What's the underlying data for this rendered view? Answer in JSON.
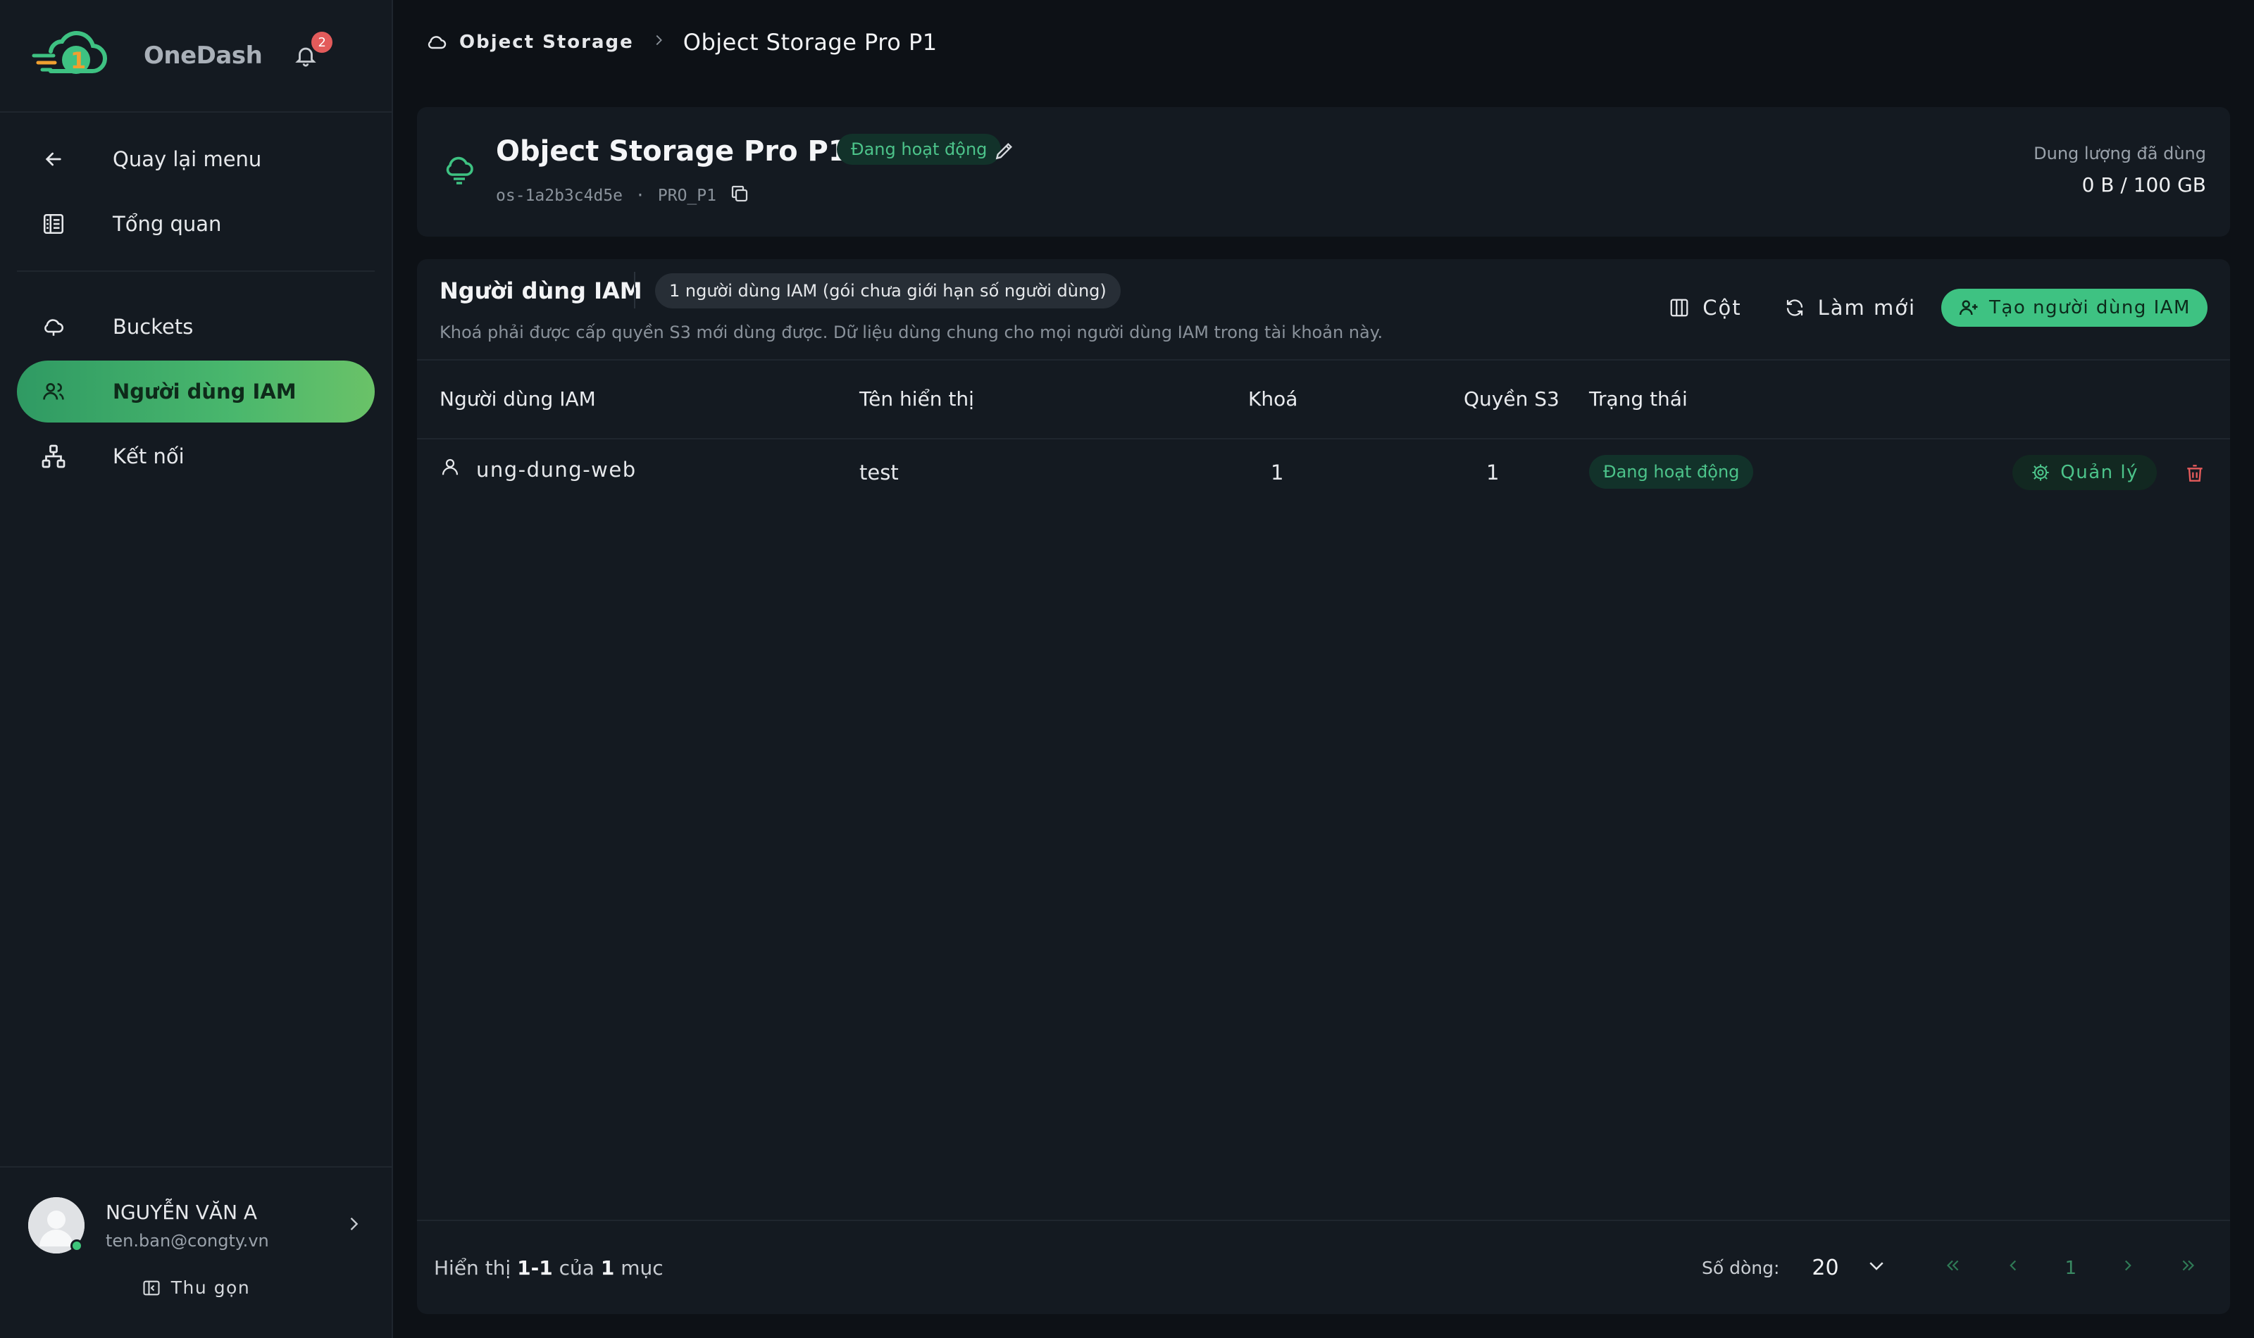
{
  "app": {
    "name": "OneDash",
    "notification_count": "2",
    "accent": "#3ec282"
  },
  "sidebar": {
    "top_items": [
      {
        "label": "Quay lại menu",
        "icon": "arrow-left-icon"
      },
      {
        "label": "Tổng quan",
        "icon": "overview-icon"
      }
    ],
    "items": [
      {
        "label": "Buckets",
        "icon": "cloud-icon"
      },
      {
        "label": "Người dùng IAM",
        "icon": "users-icon",
        "active": true
      },
      {
        "label": "Kết nối",
        "icon": "network-icon"
      }
    ],
    "user": {
      "name": "NGUYỄN VĂN A",
      "email": "ten.ban@congty.vn"
    },
    "collapse_label": "Thu gọn"
  },
  "breadcrumb": {
    "root": "Object Storage",
    "current": "Object Storage Pro P1"
  },
  "header": {
    "title": "Object Storage Pro P1",
    "status": "Đang hoạt động",
    "id": "os-1a2b3c4d5e",
    "separator": "·",
    "plan": "PRO_P1",
    "usage_label": "Dung lượng đã dùng",
    "usage_value": "0 B / 100 GB"
  },
  "iam": {
    "title": "Người dùng IAM",
    "count_badge": "1 người dùng IAM (gói chưa giới hạn số người dùng)",
    "description": "Khoá phải được cấp quyền S3 mới dùng được. Dữ liệu dùng chung cho mọi người dùng IAM trong tài khoản này.",
    "columns_button": "Cột",
    "refresh_button": "Làm mới",
    "create_button": "Tạo người dùng IAM",
    "columns": [
      "Người dùng IAM",
      "Tên hiển thị",
      "Khoá",
      "Quyền S3",
      "Trạng thái"
    ],
    "rows": [
      {
        "user": "ung-dung-web",
        "display_name": "test",
        "keys": "1",
        "s3_perms": "1",
        "status": "Đang hoạt động",
        "manage": "Quản lý"
      }
    ],
    "footer": {
      "showing_prefix": "Hiển thị",
      "range": "1-1",
      "of": "của",
      "total": "1",
      "unit": "mục",
      "rows_label": "Số dòng:",
      "rows_value": "20",
      "page": "1"
    }
  }
}
